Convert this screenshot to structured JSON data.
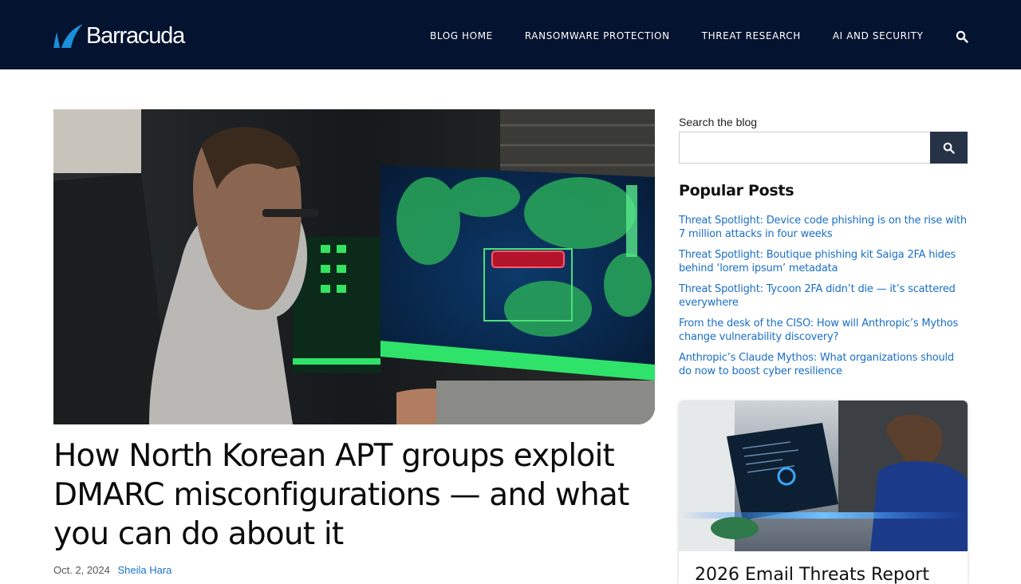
{
  "brand": {
    "name": "Barracuda"
  },
  "nav": {
    "items": [
      "BLOG HOME",
      "RANSOMWARE PROTECTION",
      "THREAT RESEARCH",
      "AI AND SECURITY"
    ]
  },
  "article": {
    "title": "How North Korean APT groups exploit DMARC misconfigurations — and what you can do about it",
    "date": "Oct. 2, 2024",
    "author": "Sheila Hara"
  },
  "sidebar": {
    "search_label": "Search the blog",
    "search_value": "",
    "popular_title": "Popular Posts",
    "popular_posts": [
      "Threat Spotlight: Device code phishing is on the rise with 7 million attacks in four weeks",
      "Threat Spotlight: Boutique phishing kit Saiga 2FA hides behind ‘lorem ipsum’ metadata",
      "Threat Spotlight: Tycoon 2FA didn’t die — it’s scattered everywhere",
      "From the desk of the CISO: How will Anthropic’s Mythos change vulnerability discovery?",
      "Anthropic’s Claude Mythos: What organizations should do now to boost cyber resilience"
    ],
    "promo_card_title": "2026 Email Threats Report"
  },
  "icons": {
    "search": "search-icon",
    "logo": "barracuda-fin-logo"
  },
  "colors": {
    "header_bg": "#04132f",
    "link": "#1a6fc6",
    "search_button": "#263346",
    "logo_accent": "#1b8fd9"
  }
}
